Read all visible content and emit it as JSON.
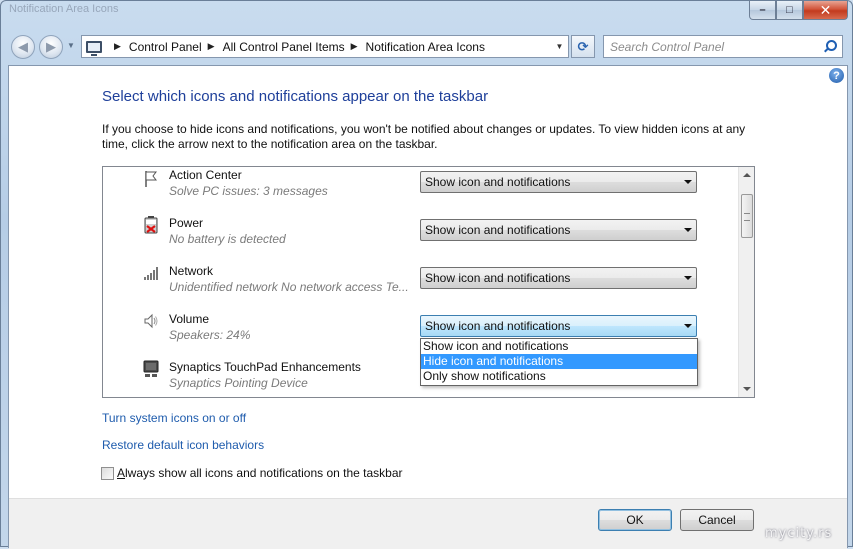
{
  "window": {
    "ghost_title": "Notification Area Icons",
    "caption": {
      "minimize": "–",
      "maximize": "□",
      "close": "✕"
    }
  },
  "nav": {
    "back": "◀",
    "forward": "▶",
    "dropdown": "▼"
  },
  "address": {
    "crumbs": [
      "Control Panel",
      "All Control Panel Items",
      "Notification Area Icons"
    ],
    "separator": "▶",
    "dropdown": "▼",
    "refresh": "⟳"
  },
  "search": {
    "placeholder": "Search Control Panel"
  },
  "help": {
    "glyph": "?"
  },
  "main": {
    "heading": "Select which icons and notifications appear on the taskbar",
    "description": "If you choose to hide icons and notifications, you won't be notified about changes or updates. To view hidden icons at any time, click the arrow next to the notification area on the taskbar.",
    "rows": [
      {
        "name": "Action Center",
        "sub": "Solve PC issues: 3 messages",
        "behavior": "Show icon and notifications",
        "icon": "flag-icon"
      },
      {
        "name": "Power",
        "sub": "No battery is detected",
        "behavior": "Show icon and notifications",
        "icon": "battery-icon"
      },
      {
        "name": "Network",
        "sub": "Unidentified network No network access Te...",
        "behavior": "Show icon and notifications",
        "icon": "network-signal-icon"
      },
      {
        "name": "Volume",
        "sub": "Speakers: 24%",
        "behavior": "Show icon and notifications",
        "icon": "speaker-icon"
      },
      {
        "name": "Synaptics TouchPad Enhancements",
        "sub": "Synaptics Pointing Device",
        "behavior": "",
        "icon": "touchpad-icon"
      }
    ],
    "dropdown_options": [
      "Show icon and notifications",
      "Hide icon and notifications",
      "Only show notifications"
    ],
    "dropdown_selected_index": 1,
    "links": {
      "system_icons": "Turn system icons on or off",
      "restore": "Restore default icon behaviors"
    },
    "checkbox": {
      "accel": "A",
      "label_rest": "lways show all icons and notifications on the taskbar",
      "checked": false
    }
  },
  "footer": {
    "ok": "OK",
    "cancel": "Cancel"
  },
  "watermark": "mycity.rs",
  "colors": {
    "heading": "#1e3f9a",
    "link": "#1f5cad",
    "selection": "#3399ff"
  }
}
